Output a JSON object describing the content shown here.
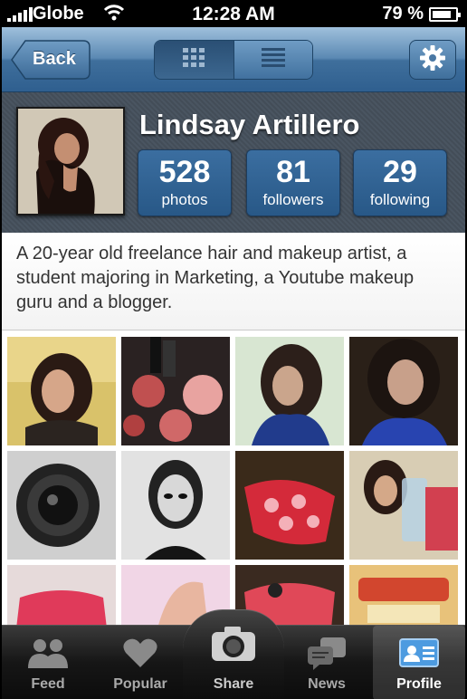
{
  "status_bar": {
    "carrier": "Globe",
    "time": "12:28 AM",
    "battery": "79 %",
    "battery_level": 0.79
  },
  "nav": {
    "back_label": "Back",
    "view_modes": [
      "grid-icon",
      "list-icon"
    ],
    "active_view": "grid",
    "settings_icon": "gear-icon"
  },
  "profile": {
    "name": "Lindsay Artillero",
    "stats": [
      {
        "value": "528",
        "label": "photos"
      },
      {
        "value": "81",
        "label": "followers"
      },
      {
        "value": "29",
        "label": "following"
      }
    ],
    "bio": "A 20-year old freelance hair and makeup artist, a student majoring in Marketing, a Youtube makeup guru and a blogger."
  },
  "photo_grid": {
    "count_visible": 12
  },
  "tabbar": {
    "tabs": [
      {
        "label": "Feed",
        "icon": "people-icon"
      },
      {
        "label": "Popular",
        "icon": "heart-icon"
      },
      {
        "label": "Share",
        "icon": "camera-icon"
      },
      {
        "label": "News",
        "icon": "speech-bubbles-icon"
      },
      {
        "label": "Profile",
        "icon": "profile-card-icon"
      }
    ],
    "active": "Profile"
  },
  "colors": {
    "nav_blue": "#3f6f9c",
    "stat_blue": "#285887",
    "header_gray": "#4a5561",
    "tab_dark": "#161616"
  }
}
